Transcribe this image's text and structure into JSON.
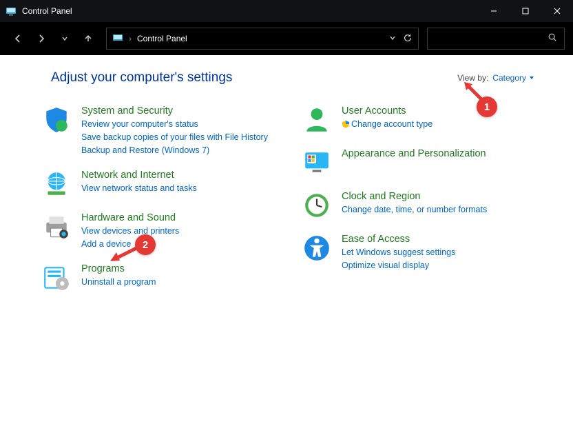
{
  "titlebar": {
    "title": "Control Panel"
  },
  "address": {
    "location": "Control Panel"
  },
  "header": {
    "title": "Adjust your computer's settings"
  },
  "viewby": {
    "label": "View by:",
    "value": "Category"
  },
  "left": [
    {
      "heading": "System and Security",
      "links": [
        "Review your computer's status",
        "Save backup copies of your files with File History",
        "Backup and Restore (Windows 7)"
      ]
    },
    {
      "heading": "Network and Internet",
      "links": [
        "View network status and tasks"
      ]
    },
    {
      "heading": "Hardware and Sound",
      "links": [
        "View devices and printers",
        "Add a device"
      ]
    },
    {
      "heading": "Programs",
      "links": [
        "Uninstall a program"
      ]
    }
  ],
  "right": [
    {
      "heading": "User Accounts",
      "links": [
        "Change account type"
      ],
      "shielded": [
        0
      ]
    },
    {
      "heading": "Appearance and Personalization",
      "links": []
    },
    {
      "heading": "Clock and Region",
      "links": [
        "Change date, time, or number formats"
      ]
    },
    {
      "heading": "Ease of Access",
      "links": [
        "Let Windows suggest settings",
        "Optimize visual display"
      ]
    }
  ],
  "annotations": {
    "badge1": "1",
    "badge2": "2"
  }
}
